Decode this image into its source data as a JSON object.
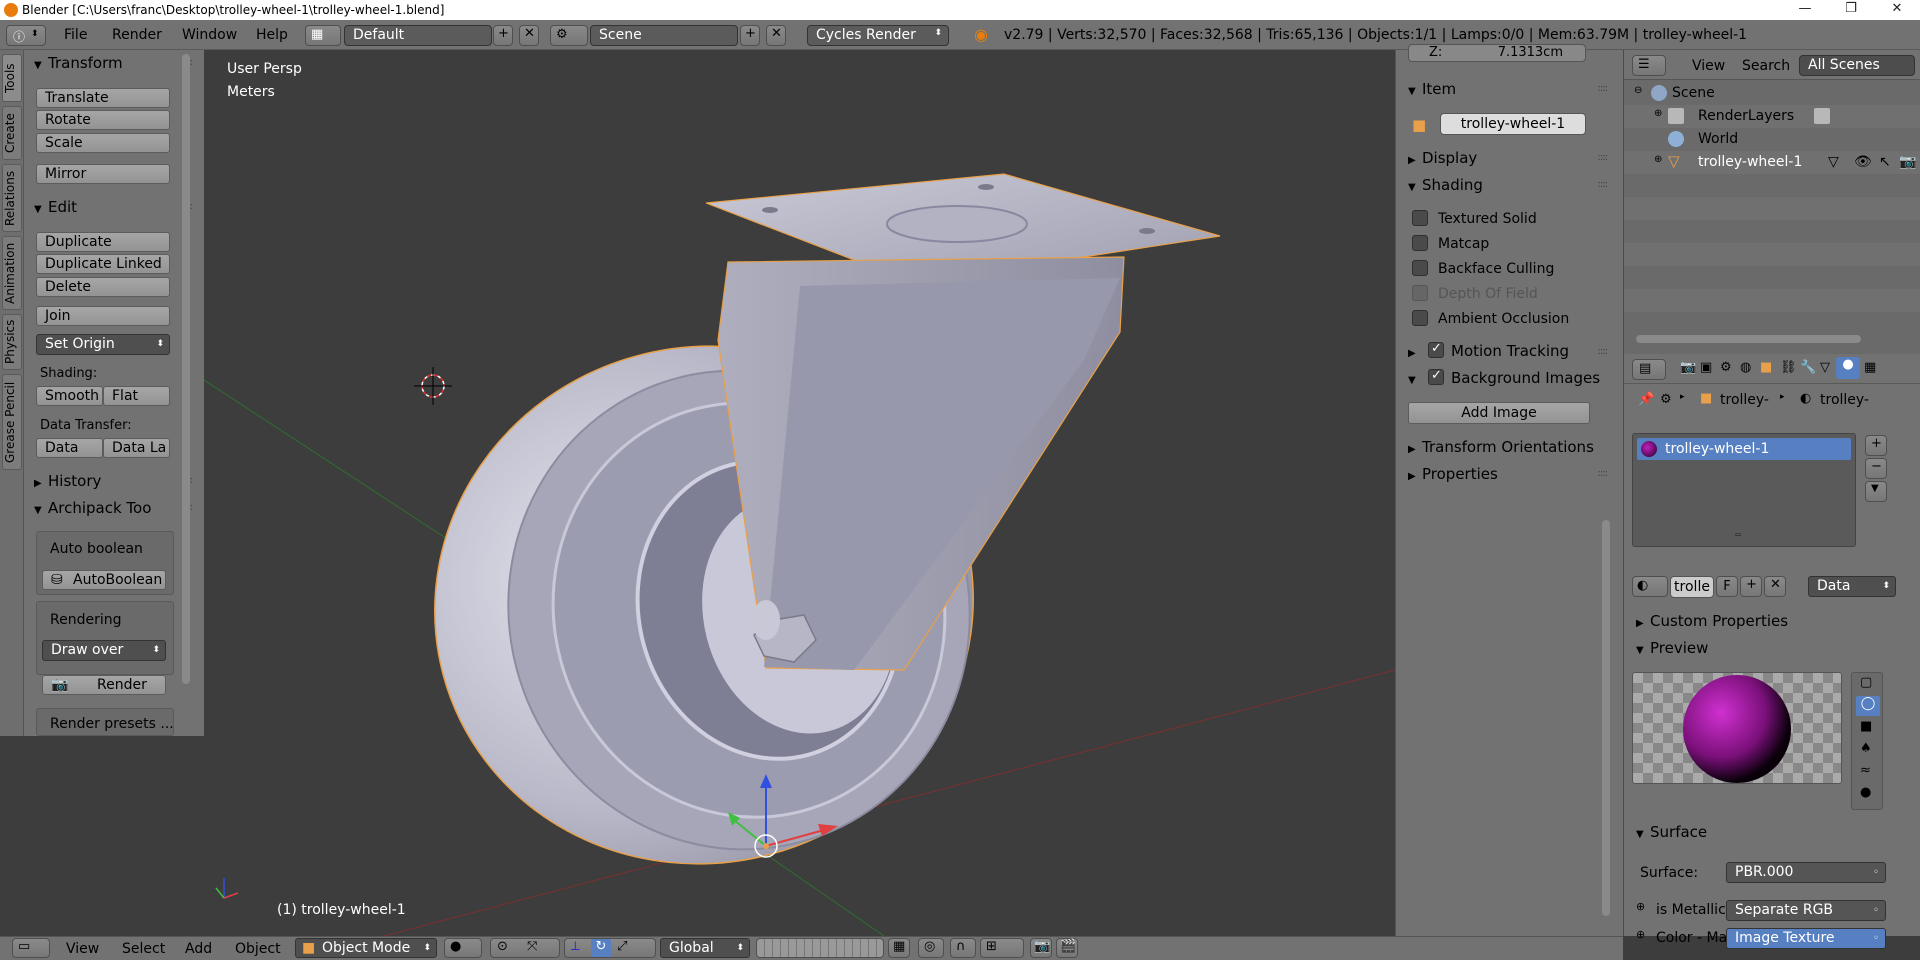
{
  "window": {
    "title": "Blender [C:\\Users\\franc\\Desktop\\trolley-wheel-1\\trolley-wheel-1.blend]",
    "controls": [
      "—",
      "❐",
      "✕"
    ]
  },
  "info_header": {
    "menus": [
      "File",
      "Render",
      "Window",
      "Help"
    ],
    "screen_layout": "Default",
    "scene": "Scene",
    "render_engine": "Cycles Render",
    "stats": "v2.79 | Verts:32,570 | Faces:32,568 | Tris:65,136 | Objects:1/1 | Lamps:0/0 | Mem:63.79M | trolley-wheel-1"
  },
  "tool_tabs": [
    "Tools",
    "Create",
    "Relations",
    "Animation",
    "Physics",
    "Grease Pencil"
  ],
  "tool_shelf": {
    "transform": {
      "header": "Transform",
      "buttons": [
        "Translate",
        "Rotate",
        "Scale",
        "Mirror"
      ]
    },
    "edit": {
      "header": "Edit",
      "buttons": [
        "Duplicate",
        "Duplicate Linked",
        "Delete",
        "Join"
      ],
      "set_origin": "Set Origin",
      "shading_label": "Shading:",
      "smooth": "Smooth",
      "flat": "Flat",
      "data_transfer_label": "Data Transfer:",
      "data": "Data",
      "data_layers": "Data La"
    },
    "history": {
      "header": "History"
    },
    "archipack": {
      "header": "Archipack Too",
      "auto_boolean_label": "Auto boolean",
      "autoboolean_button": "AutoBoolean",
      "rendering_label": "Rendering",
      "draw_over": "Draw over",
      "render_button": "Render",
      "render_presets": "Render presets ..."
    }
  },
  "viewport": {
    "view_name": "User Persp",
    "units": "Meters",
    "object_label": "(1) trolley-wheel-1"
  },
  "n_panel": {
    "z_label": "Z:",
    "z_value": "7.1313cm",
    "item": {
      "header": "Item",
      "name": "trolley-wheel-1"
    },
    "display": {
      "header": "Display"
    },
    "shading": {
      "header": "Shading",
      "options": [
        {
          "label": "Textured Solid",
          "checked": false,
          "enabled": true
        },
        {
          "label": "Matcap",
          "checked": false,
          "enabled": true
        },
        {
          "label": "Backface Culling",
          "checked": false,
          "enabled": true
        },
        {
          "label": "Depth Of Field",
          "checked": false,
          "enabled": false
        },
        {
          "label": "Ambient Occlusion",
          "checked": false,
          "enabled": true
        }
      ]
    },
    "motion_tracking": {
      "header": "Motion Tracking",
      "checked": true
    },
    "background_images": {
      "header": "Background Images",
      "checked": true,
      "add_image": "Add Image"
    },
    "transform_orientations": {
      "header": "Transform Orientations"
    },
    "properties": {
      "header": "Properties"
    }
  },
  "outliner": {
    "view_menu": "View",
    "search_menu": "Search",
    "filter": "All Scenes",
    "items": [
      {
        "label": "Scene",
        "icon": "scene-icon"
      },
      {
        "label": "RenderLayers",
        "icon": "render-layers-icon"
      },
      {
        "label": "World",
        "icon": "world-icon"
      },
      {
        "label": "trolley-wheel-1",
        "icon": "mesh-object-icon"
      }
    ]
  },
  "properties_editor": {
    "breadcrumb_object": "trolley-",
    "breadcrumb_material": "trolley-",
    "material_slot": "trolley-wheel-1",
    "material_name": "trolle",
    "fake_user": "F",
    "link_mode": "Data",
    "custom_properties": "Custom Properties",
    "preview": "Preview",
    "surface": {
      "header": "Surface",
      "surface_label": "Surface:",
      "surface_value": "PBR.000",
      "is_metallic_label": "is Metallic",
      "is_metallic_value": "Separate RGB",
      "color_label": "Color - Ma",
      "color_value": "Image Texture"
    }
  },
  "bottom_header": {
    "menus": [
      "View",
      "Select",
      "Add",
      "Object"
    ],
    "mode": "Object Mode",
    "orientation": "Global"
  },
  "colors": {
    "header_bg": "#727272",
    "viewport_bg": "#3d3d3d",
    "selection_outline": "#e8a04a",
    "selected_row": "#5680c2",
    "axis_x": "#e04040",
    "axis_y": "#40c040",
    "axis_z": "#3050e0"
  }
}
